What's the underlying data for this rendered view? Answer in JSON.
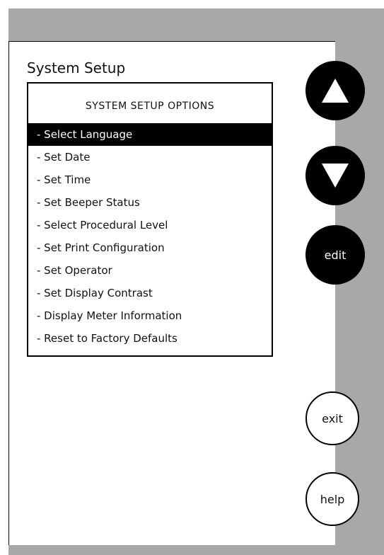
{
  "screen": {
    "title": "System Setup"
  },
  "options_panel": {
    "header": "SYSTEM SETUP OPTIONS",
    "items": [
      {
        "label": "- Select Language",
        "selected": true
      },
      {
        "label": "- Set Date",
        "selected": false
      },
      {
        "label": "- Set Time",
        "selected": false
      },
      {
        "label": "- Set Beeper Status",
        "selected": false
      },
      {
        "label": "- Select Procedural Level",
        "selected": false
      },
      {
        "label": "- Set Print Configuration",
        "selected": false
      },
      {
        "label": "- Set Operator",
        "selected": false
      },
      {
        "label": "- Set Display Contrast",
        "selected": false
      },
      {
        "label": "- Display Meter Information",
        "selected": false
      },
      {
        "label": "- Reset to Factory Defaults",
        "selected": false
      }
    ]
  },
  "buttons": {
    "up_icon": "triangle-up-icon",
    "down_icon": "triangle-down-icon",
    "edit": "edit",
    "exit": "exit",
    "help": "help"
  },
  "colors": {
    "frame_gray": "#a8a8a8",
    "selection_bg": "#000000",
    "selection_text": "#ffffff"
  }
}
